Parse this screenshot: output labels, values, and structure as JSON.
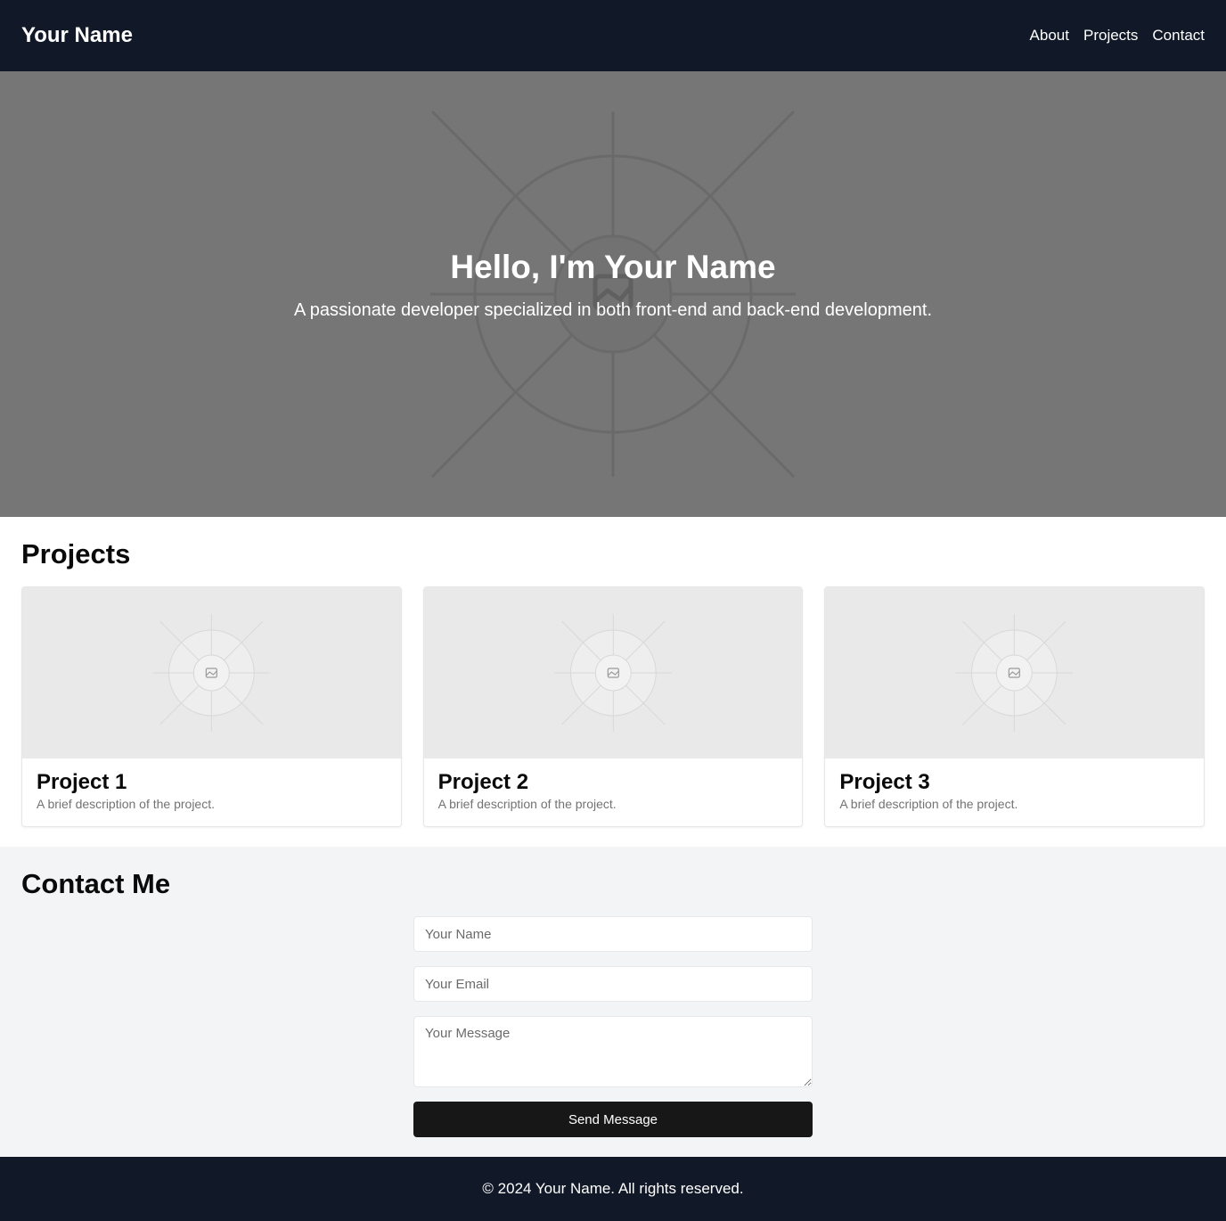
{
  "header": {
    "brand": "Your Name",
    "nav": [
      {
        "label": "About"
      },
      {
        "label": "Projects"
      },
      {
        "label": "Contact"
      }
    ]
  },
  "hero": {
    "title": "Hello, I'm Your Name",
    "subtitle": "A passionate developer specialized in both front-end and back-end development.",
    "background_icon": "image-placeholder-icon"
  },
  "projects": {
    "title": "Projects",
    "items": [
      {
        "title": "Project 1",
        "description": "A brief description of the project.",
        "icon": "image-placeholder-icon"
      },
      {
        "title": "Project 2",
        "description": "A brief description of the project.",
        "icon": "image-placeholder-icon"
      },
      {
        "title": "Project 3",
        "description": "A brief description of the project.",
        "icon": "image-placeholder-icon"
      }
    ]
  },
  "contact": {
    "title": "Contact Me",
    "name_placeholder": "Your Name",
    "email_placeholder": "Your Email",
    "message_placeholder": "Your Message",
    "submit_label": "Send Message"
  },
  "footer": {
    "copyright": "© 2024 Your Name. All rights reserved."
  },
  "colors": {
    "header_bg": "#111827",
    "hero_bg": "#767676",
    "contact_bg": "#f3f4f6",
    "button_bg": "#171717"
  }
}
